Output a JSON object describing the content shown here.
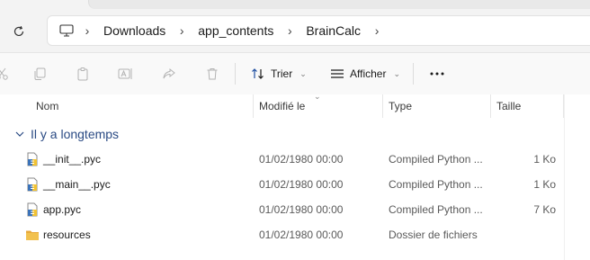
{
  "breadcrumbs": [
    "Downloads",
    "app_contents",
    "BrainCalc"
  ],
  "toolbar": {
    "sort_label": "Trier",
    "view_label": "Afficher",
    "more_label": "..."
  },
  "columns": {
    "name": "Nom",
    "modified": "Modifié le",
    "type": "Type",
    "size": "Taille"
  },
  "group": {
    "label": "Il y a longtemps"
  },
  "files": [
    {
      "name": "__init__.pyc",
      "modified": "01/02/1980 00:00",
      "type": "Compiled Python ...",
      "size": "1 Ko",
      "icon": "python-file-icon"
    },
    {
      "name": "__main__.pyc",
      "modified": "01/02/1980 00:00",
      "type": "Compiled Python ...",
      "size": "1 Ko",
      "icon": "python-file-icon"
    },
    {
      "name": "app.pyc",
      "modified": "01/02/1980 00:00",
      "type": "Compiled Python ...",
      "size": "7 Ko",
      "icon": "python-file-icon"
    },
    {
      "name": "resources",
      "modified": "01/02/1980 00:00",
      "type": "Dossier de fichiers",
      "size": "",
      "icon": "folder-icon"
    }
  ],
  "colors": {
    "group_text": "#2b4b84",
    "folder": "#f2c14e",
    "disabled_icon": "#b3b3b3"
  }
}
